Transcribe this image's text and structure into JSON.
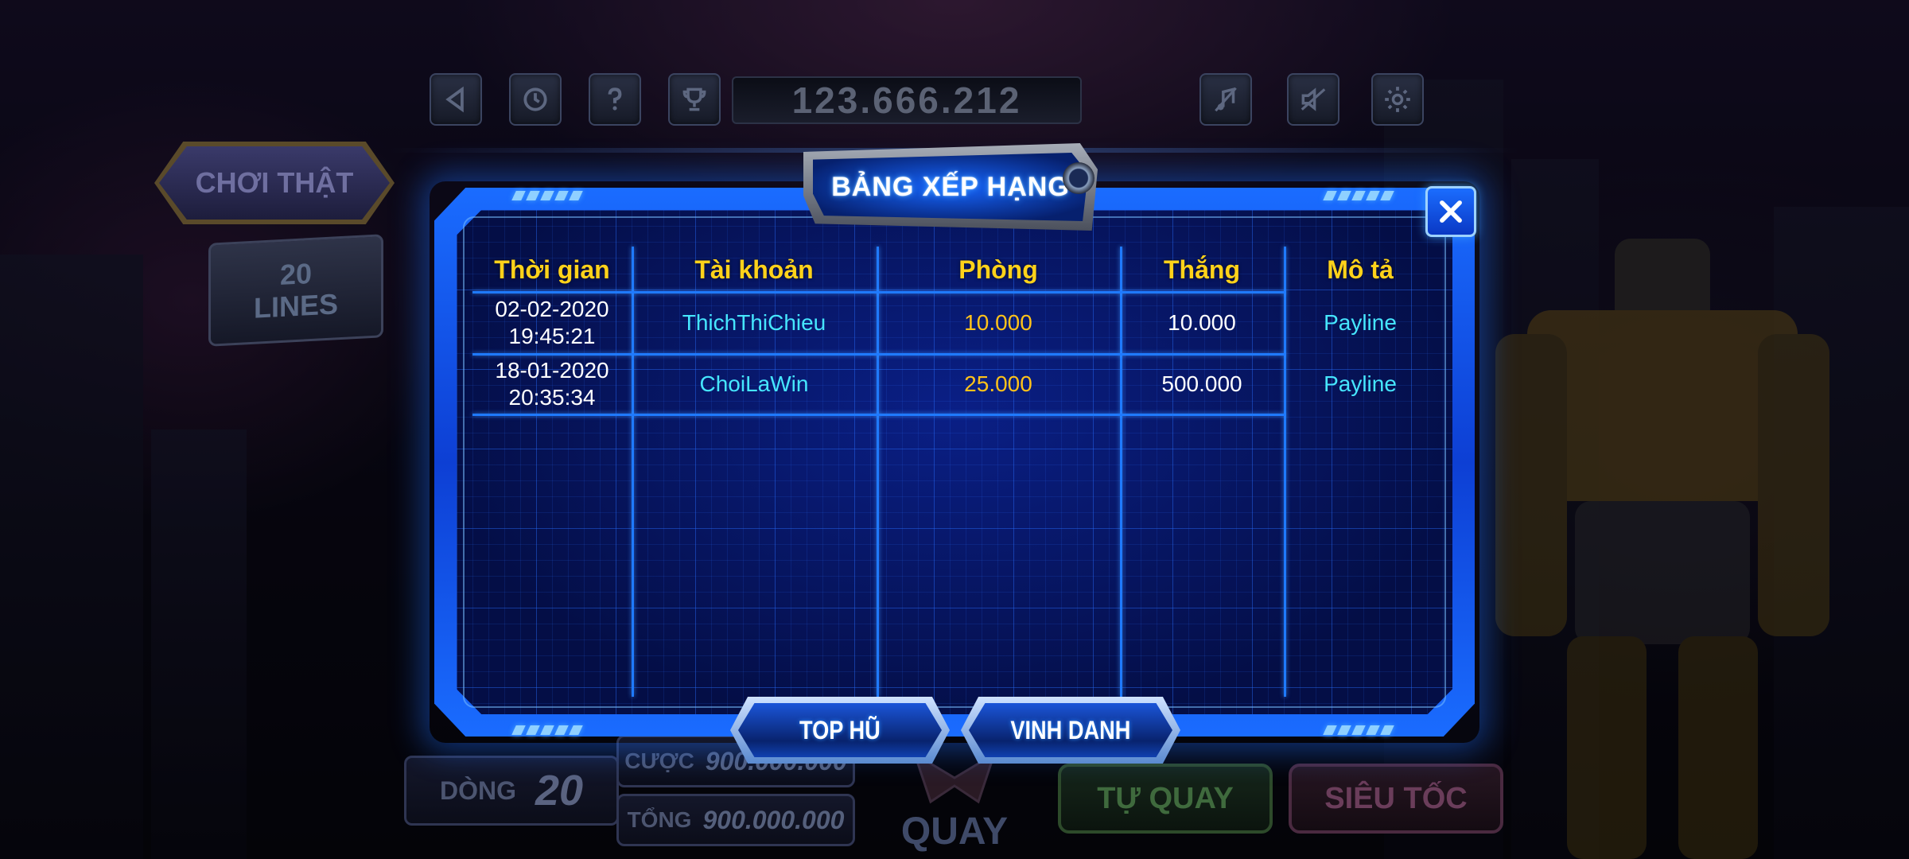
{
  "topbar": {
    "balance": "123.666.212",
    "buttons": [
      {
        "name": "back-icon"
      },
      {
        "name": "history-icon"
      },
      {
        "name": "help-icon"
      },
      {
        "name": "trophy-icon"
      },
      {
        "name": "music-off-icon"
      },
      {
        "name": "sound-off-icon"
      },
      {
        "name": "gear-icon"
      }
    ]
  },
  "left_panel": {
    "mode_label": "CHƠI THẬT",
    "lines_count": "20",
    "lines_label": "LINES"
  },
  "bottom_bar": {
    "lines_label": "DÒNG",
    "lines_value": "20",
    "bet_label": "CƯỢC",
    "bet_value": "900.000.000",
    "total_label": "TỔNG",
    "total_value": "900.000.000",
    "spin_label": "QUAY",
    "auto_spin_label": "TỰ QUAY",
    "turbo_label": "SIÊU TỐC"
  },
  "modal": {
    "title": "BẢNG XẾP HẠNG",
    "columns": [
      "Thời gian",
      "Tài khoản",
      "Phòng",
      "Thắng",
      "Mô tả"
    ],
    "rows": [
      {
        "date": "02-02-2020",
        "time": "19:45:21",
        "account": "ThichThiChieu",
        "room": "10.000",
        "win": "10.000",
        "description": "Payline"
      },
      {
        "date": "18-01-2020",
        "time": "20:35:34",
        "account": "ChoiLaWin",
        "room": "25.000",
        "win": "500.000",
        "description": "Payline"
      }
    ],
    "tabs": [
      "TOP HŨ",
      "VINH DANH"
    ],
    "colors": {
      "header": "#ffd21a",
      "account": "#46e6ff",
      "room": "#ffc21a",
      "frame": "#1a6cff"
    }
  }
}
